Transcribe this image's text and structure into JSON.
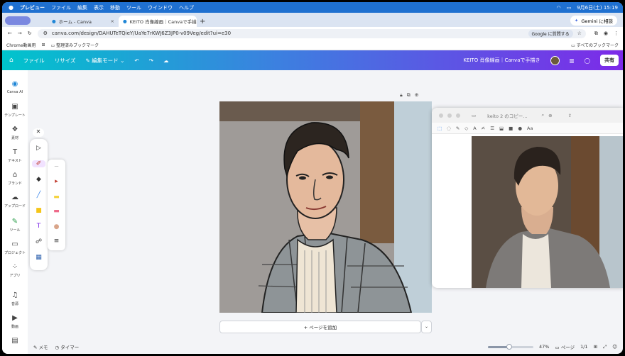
{
  "macbar": {
    "apple": "",
    "items": [
      "プレビュー",
      "ファイル",
      "編集",
      "表示",
      "移動",
      "ツール",
      "ウインドウ",
      "ヘルプ"
    ],
    "gemini": "Gemini に相談",
    "datetime": "9月6日(土) 15:19"
  },
  "tabs": [
    {
      "label": "ホーム - Canva",
      "close": "×"
    },
    {
      "label": "KEITO 肖像線画｜Canvaで手描",
      "close": "×"
    }
  ],
  "url": {
    "address": "canva.com/design/DAHUTeTQieY/UaYe7rKWJ6Z3JP0-v09Veg/edit?ui=e30",
    "google": "Google に質問する"
  },
  "bookmarks": {
    "item1": "Chrome動画用",
    "item2": "整理済みブックマーク",
    "all": "すべてのブックマーク"
  },
  "canva": {
    "file": "ファイル",
    "resize": "リサイズ",
    "edit_mode": "編集モード",
    "doc_title": "KEITO 肖像線画｜Canvaで手描き",
    "share": "共有"
  },
  "sidebar": [
    {
      "label": "Canva AI",
      "icon": "canva-ai-icon"
    },
    {
      "label": "テンプレート",
      "icon": "template-icon"
    },
    {
      "label": "素材",
      "icon": "elements-icon"
    },
    {
      "label": "テキスト",
      "icon": "text-icon"
    },
    {
      "label": "ブランド",
      "icon": "brand-icon"
    },
    {
      "label": "アップロード",
      "icon": "upload-icon"
    },
    {
      "label": "ツール",
      "icon": "tools-icon"
    },
    {
      "label": "プロジェクト",
      "icon": "projects-icon"
    },
    {
      "label": "アプリ",
      "icon": "apps-icon"
    },
    {
      "label": "音源",
      "icon": "audio-icon"
    },
    {
      "label": "動画",
      "icon": "video-icon"
    }
  ],
  "preview": {
    "title": "keito 2 のコピー..."
  },
  "footer": {
    "memo": "メモ",
    "timer": "タイマー",
    "zoom": "47%",
    "zoom_fraction": 0.47,
    "pages_label": "ページ",
    "page_count": "1/1"
  },
  "addpage": "+ ページを追加"
}
